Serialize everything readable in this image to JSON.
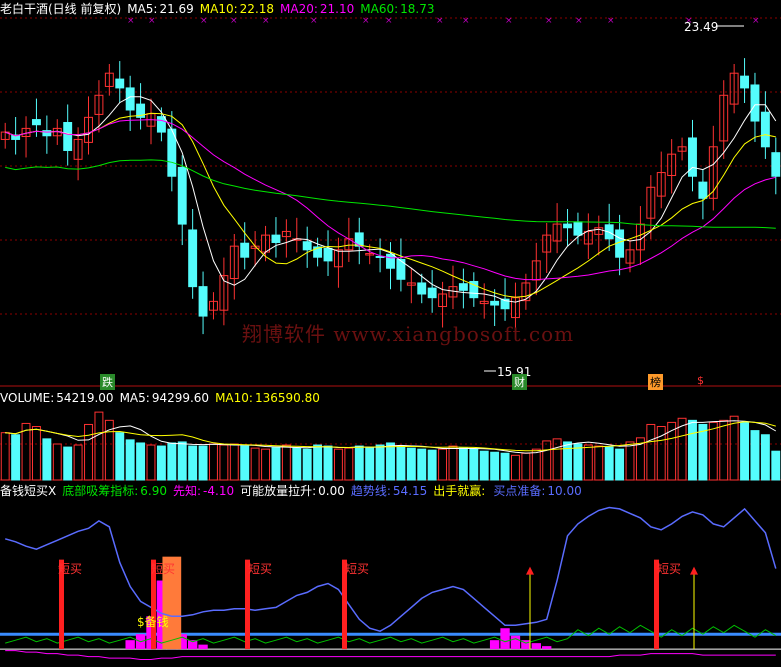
{
  "price_header": {
    "title": "老白干酒(日线 前复权)",
    "ma5_label": "MA5:",
    "ma5_value": "21.69",
    "ma10_label": "MA10:",
    "ma10_value": "22.18",
    "ma20_label": "MA20:",
    "ma20_value": "21.10",
    "ma60_label": "MA60:",
    "ma60_value": "18.73"
  },
  "volume_header": {
    "label": "VOLUME:",
    "value": "54219.00",
    "ma5_label": "MA5:",
    "ma5_value": "94299.60",
    "ma10_label": "MA10:",
    "ma10_value": "136590.80"
  },
  "indicator_header": {
    "name": "备钱短买X",
    "f1_label": "底部吸筹指标:",
    "f1_value": "6.90",
    "f2_label": "先知:",
    "f2_value": "-4.10",
    "f3_label": "可能放量拉升:",
    "f3_value": "0.00",
    "f4_label": "趋势线:",
    "f4_value": "54.15",
    "f5_label": "出手就赢:",
    "f5_value": "",
    "f6_label": "买点准备:",
    "f6_value": "10.00"
  },
  "annotations": {
    "high_label": "23.49",
    "low_label": "15.91",
    "buy_label": "短买",
    "money_label": "$备钱",
    "event_die": "跌",
    "event_cai": "财",
    "event_bang": "榜",
    "event_dollar": "$",
    "watermark": "翔博软件 www.xiangbosoft.com"
  },
  "colors": {
    "up": "#ff3232",
    "down": "#54fcfc",
    "ma5": "#ffffff",
    "ma10": "#ffff00",
    "ma20": "#ff00ff",
    "ma60": "#00e600",
    "trend": "#5a6cff",
    "bg": "#000000",
    "grid": "#8b0000"
  },
  "chart_data": {
    "type": "candlestick",
    "price": {
      "ylim": [
        14.5,
        24.5
      ],
      "high_point": 23.49,
      "low_point": 15.91,
      "close": [
        21.4,
        21.2,
        21.5,
        21.6,
        21.3,
        21.5,
        20.9,
        21.2,
        21.8,
        22.4,
        23.0,
        22.6,
        22.0,
        21.8,
        21.9,
        21.4,
        20.2,
        18.9,
        17.2,
        16.4,
        16.8,
        17.5,
        18.3,
        18.0,
        18.3,
        18.6,
        18.4,
        18.7,
        18.5,
        18.2,
        18.0,
        17.9,
        18.2,
        18.5,
        18.3,
        18.1,
        18.0,
        17.7,
        17.4,
        17.3,
        17.0,
        16.9,
        17.0,
        17.2,
        17.1,
        16.9,
        16.8,
        16.7,
        16.6,
        16.9,
        17.3,
        17.9,
        18.6,
        18.9,
        18.8,
        18.6,
        18.7,
        18.8,
        18.5,
        18.0,
        18.2,
        18.9,
        19.9,
        20.3,
        20.8,
        21.0,
        20.2,
        19.6,
        21.0,
        22.4,
        23.0,
        22.6,
        21.7,
        21.0,
        20.2
      ]
    },
    "volume": {
      "values": [
        46,
        44,
        55,
        52,
        40,
        35,
        32,
        34,
        54,
        66,
        58,
        46,
        39,
        36,
        34,
        33,
        36,
        37,
        33,
        33,
        35,
        34,
        35,
        33,
        31,
        30,
        32,
        34,
        31,
        30,
        34,
        33,
        30,
        31,
        33,
        32,
        34,
        36,
        33,
        31,
        30,
        29,
        30,
        33,
        31,
        30,
        28,
        27,
        26,
        24,
        26,
        30,
        38,
        40,
        37,
        35,
        34,
        33,
        32,
        30,
        37,
        41,
        54,
        52,
        56,
        60,
        58,
        54,
        56,
        58,
        62,
        56,
        48,
        44,
        28
      ]
    },
    "indicator": {
      "ylim": [
        -12,
        100
      ],
      "trend_line": [
        74,
        72,
        69,
        67,
        70,
        73,
        76,
        79,
        81,
        86,
        82,
        58,
        42,
        32,
        28,
        24,
        22,
        22,
        23,
        25,
        26,
        26,
        27,
        27,
        26,
        27,
        28,
        32,
        36,
        38,
        42,
        44,
        40,
        30,
        20,
        14,
        12,
        16,
        22,
        28,
        34,
        38,
        40,
        42,
        40,
        34,
        28,
        22,
        16,
        16,
        17,
        18,
        20,
        46,
        76,
        84,
        89,
        93,
        95,
        94,
        91,
        88,
        82,
        80,
        84,
        89,
        92,
        90,
        84,
        82,
        88,
        94,
        86,
        78,
        54
      ],
      "bottom_accumulation": [
        0,
        0,
        0,
        0,
        0,
        0,
        0,
        0,
        0,
        0,
        0,
        0,
        6,
        10,
        22,
        46,
        28,
        10,
        6,
        3,
        0,
        0,
        0,
        0,
        0,
        0,
        0,
        0,
        0,
        0,
        0,
        0,
        0,
        0,
        0,
        0,
        0,
        0,
        0,
        0,
        0,
        0,
        0,
        0,
        0,
        0,
        0,
        6,
        14,
        9,
        6,
        4,
        2,
        0,
        0,
        0,
        0,
        0,
        0,
        0,
        0,
        0,
        0,
        0,
        0,
        0,
        0,
        0,
        0,
        0,
        0,
        0,
        0,
        0,
        0,
        0
      ],
      "foresight": [
        -1,
        -1,
        -2,
        -2,
        -3,
        -3,
        -4,
        -4,
        -5,
        -5,
        -6,
        -6,
        -6,
        -7,
        -7,
        -6,
        -6,
        -5,
        -5,
        -5,
        -5,
        -5,
        -5,
        -5,
        -5,
        -5,
        -5,
        -5,
        -5,
        -5,
        -5,
        -5,
        -5,
        -5,
        -5,
        -5,
        -5,
        -5,
        -5,
        -5,
        -5,
        -5,
        -5,
        -5,
        -5,
        -5,
        -5,
        -5,
        -5,
        -5,
        -5,
        -5,
        -5,
        -5,
        -5,
        -5,
        -5,
        -5,
        -5,
        -4,
        -4,
        -4,
        -3,
        -3,
        -3,
        -3,
        -3,
        -4,
        -4,
        -4,
        -4,
        -4,
        -4,
        -4,
        -4
      ],
      "buy_ready_level": 10,
      "short_buy_markers": [
        5,
        21,
        29
      ],
      "arrow_markers": [
        42,
        55,
        57
      ]
    }
  }
}
